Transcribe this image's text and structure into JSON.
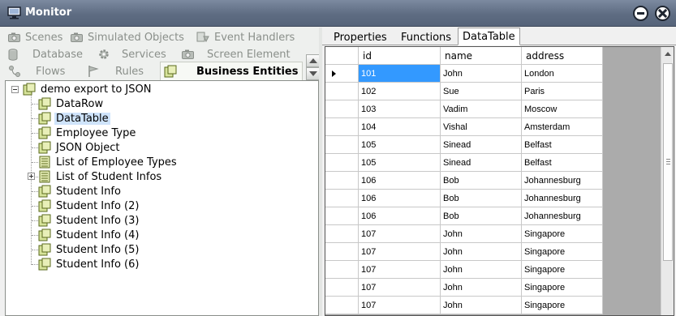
{
  "window": {
    "title": "Monitor"
  },
  "left_tabs": {
    "rows": [
      [
        {
          "label": "Scenes",
          "icon": "camera-icon"
        },
        {
          "label": "Simulated Objects",
          "icon": "camera-icon"
        },
        {
          "label": "Event Handlers",
          "icon": "event-icon"
        }
      ],
      [
        {
          "label": "Database",
          "icon": "database-icon"
        },
        {
          "label": "Services",
          "icon": "gear-icon"
        },
        {
          "label": "Screen Element",
          "icon": "camera-icon"
        }
      ],
      [
        {
          "label": "Flows",
          "icon": "flow-icon"
        },
        {
          "label": "Rules",
          "icon": "flag-icon"
        },
        {
          "label": "Business Entities",
          "icon": "entity-icon",
          "active": true
        }
      ]
    ]
  },
  "tree": {
    "root": "demo export to JSON",
    "items": [
      {
        "label": "DataRow"
      },
      {
        "label": "DataTable",
        "selected": true
      },
      {
        "label": "Employee Type"
      },
      {
        "label": "JSON Object"
      },
      {
        "label": "List of Employee Types"
      },
      {
        "label": "List of Student Infos",
        "expandable": true
      },
      {
        "label": "Student Info"
      },
      {
        "label": "Student Info (2)"
      },
      {
        "label": "Student Info (3)"
      },
      {
        "label": "Student Info (4)"
      },
      {
        "label": "Student Info (5)"
      },
      {
        "label": "Student Info (6)"
      }
    ]
  },
  "right_tabs": [
    {
      "label": "Properties"
    },
    {
      "label": "Functions"
    },
    {
      "label": "DataTable",
      "active": true
    }
  ],
  "grid": {
    "columns": [
      "id",
      "name",
      "address"
    ],
    "rows": [
      [
        "101",
        "John",
        "London"
      ],
      [
        "102",
        "Sue",
        "Paris"
      ],
      [
        "103",
        "Vadim",
        "Moscow"
      ],
      [
        "104",
        "Vishal",
        "Amsterdam"
      ],
      [
        "105",
        "Sinead",
        "Belfast"
      ],
      [
        "105",
        "Sinead",
        "Belfast"
      ],
      [
        "106",
        "Bob",
        "Johannesburg"
      ],
      [
        "106",
        "Bob",
        "Johannesburg"
      ],
      [
        "106",
        "Bob",
        "Johannesburg"
      ],
      [
        "107",
        "John",
        "Singapore"
      ],
      [
        "107",
        "John",
        "Singapore"
      ],
      [
        "107",
        "John",
        "Singapore"
      ],
      [
        "107",
        "John",
        "Singapore"
      ],
      [
        "107",
        "John",
        "Singapore"
      ]
    ]
  },
  "colors": {
    "title_bar": "#5e6c82",
    "selection": "#3399ff",
    "tree_selection": "#cfe4fb",
    "grid_background": "#ababab"
  }
}
